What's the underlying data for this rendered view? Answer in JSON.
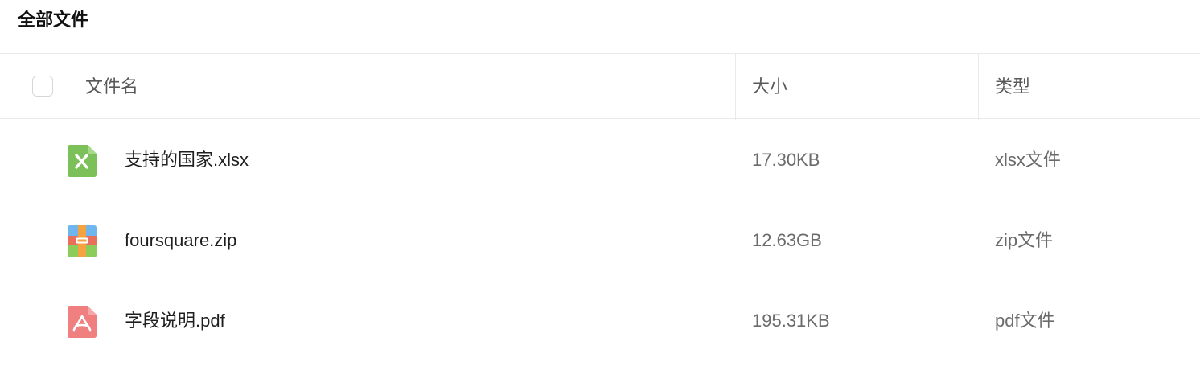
{
  "header": {
    "title": "全部文件"
  },
  "table": {
    "columns": {
      "name": "文件名",
      "size": "大小",
      "type": "类型"
    },
    "rows": [
      {
        "name": "支持的国家.xlsx",
        "size": "17.30KB",
        "type": "xlsx文件",
        "icon": "excel-file-icon"
      },
      {
        "name": "foursquare.zip",
        "size": "12.63GB",
        "type": "zip文件",
        "icon": "zip-archive-icon"
      },
      {
        "name": "字段说明.pdf",
        "size": "195.31KB",
        "type": "pdf文件",
        "icon": "pdf-file-icon"
      }
    ]
  },
  "colors": {
    "excel": "#7cc05a",
    "zip_top": "#6fb6ee",
    "zip_band": "#e96f5a",
    "zip_bottom": "#8bcc5a",
    "zip_strap": "#f4a340",
    "pdf": "#f07f80",
    "divider": "#e9e9e9"
  }
}
